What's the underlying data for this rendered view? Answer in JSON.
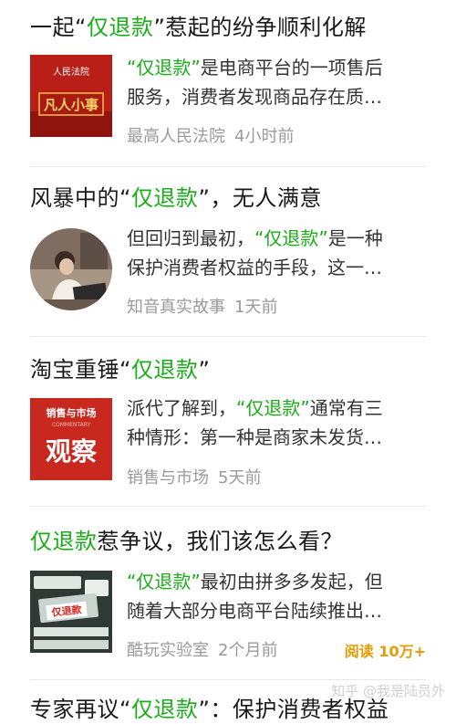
{
  "articles": [
    {
      "title_pre": "一起“",
      "title_kw": "仅退款",
      "title_post": "”惹起的纷争顺利化解",
      "thumb_icon": "people-court-program-thumbnail",
      "thumb_text_small": "人民法院",
      "thumb_text_big": "凡人小事",
      "line1_kw": "“仅退款”",
      "line1_rest": "是电商平台的一项售后",
      "line2": "服务，消费者发现商品存在质…",
      "source": "最高人民法院",
      "time": "4小时前"
    },
    {
      "title_pre": "风暴中的“",
      "title_kw": "仅退款",
      "title_post": "”，无人满意",
      "thumb_icon": "woman-laptop-photo",
      "line1_pre": "但回归到最初，",
      "line1_kw": "“仅退款”",
      "line1_rest": "是一种",
      "line2": "保护消费者权益的手段，这一…",
      "source": "知音真实故事",
      "time": "1天前"
    },
    {
      "title_pre": "淘宝重锤“",
      "title_kw": "仅退款",
      "title_post": "”",
      "thumb_icon": "sales-market-observation-logo",
      "thumb_text_small": "销售与市场",
      "thumb_text_sub": "COMMENTARY",
      "thumb_text_big": "观察",
      "line1_pre": "派代了解到，",
      "line1_kw": "“仅退款”",
      "line1_rest": "通常有三",
      "line2": "种情形：第一种是商家未发货…",
      "source": "销售与市场",
      "time": "5天前"
    },
    {
      "title_pre": "",
      "title_kw": "仅退款",
      "title_post": "惹争议，我们该怎么看？",
      "thumb_icon": "refund-dispute-screenshot",
      "thumb_text_big": "仅退款",
      "line1_kw": "“仅退款”",
      "line1_rest": "最初由拼多多发起，但",
      "line2": "随着大部分电商平台陆续推出…",
      "source": "酷玩实验室",
      "time": "2个月前",
      "reads": "阅读 10万+"
    },
    {
      "title_pre": "专家再议“",
      "title_kw": "仅退款",
      "title_post": "”：保护消费者权益"
    }
  ],
  "watermark": "知乎 @我是陆员外",
  "colors": {
    "keyword": "#1aad19",
    "meta": "#9a9a9a",
    "reads": "#e69b00",
    "thumb_red": "#c8281e"
  }
}
